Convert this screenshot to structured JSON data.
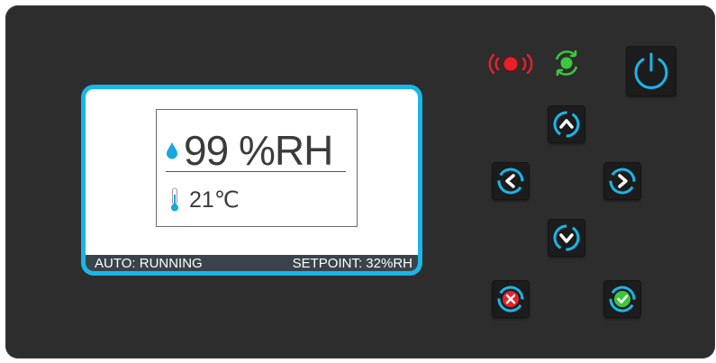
{
  "display": {
    "humidity_value": "99 %RH",
    "temperature_value": "21℃",
    "status_mode": "AUTO: RUNNING",
    "setpoint": "SETPOINT: 32%RH"
  },
  "indicators": {
    "alarm_icon": "alarm-signal-icon",
    "alarm_color": "#e8202a",
    "running_icon": "cycle-running-icon",
    "running_color": "#3cc83c"
  },
  "buttons": {
    "power": "power-icon",
    "up": "chevron-up-icon",
    "down": "chevron-down-icon",
    "left": "chevron-left-icon",
    "right": "chevron-right-icon",
    "cancel": "cancel-x-icon",
    "confirm": "confirm-check-icon"
  },
  "colors": {
    "accent": "#19b6e8",
    "panel": "#2d2d2d",
    "cancel": "#e8202a",
    "confirm": "#3cc83c"
  }
}
